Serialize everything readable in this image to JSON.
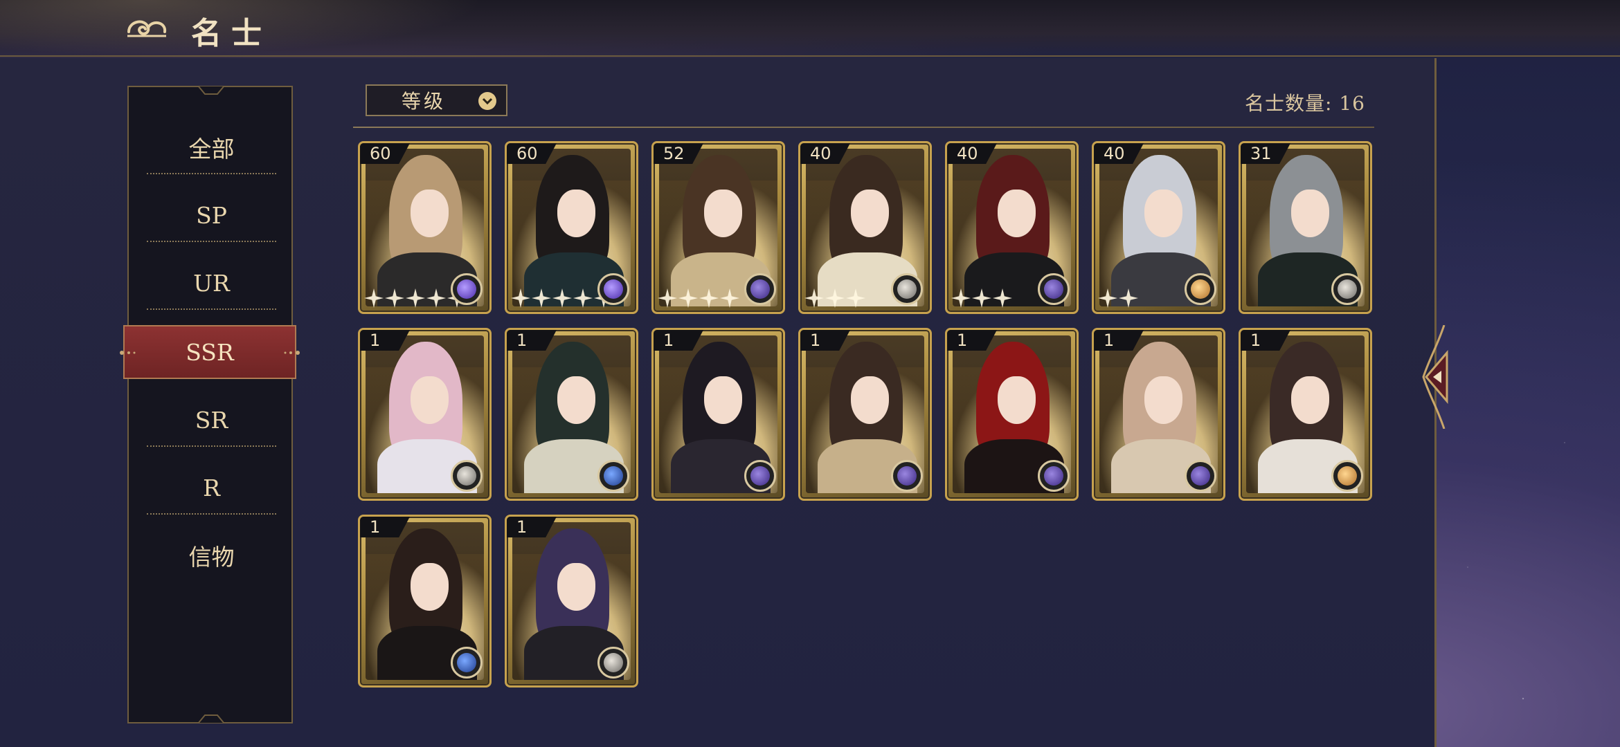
{
  "header": {
    "title": "名士"
  },
  "sidebar": {
    "tabs": [
      {
        "label": "全部"
      },
      {
        "label": "SP"
      },
      {
        "label": "UR"
      },
      {
        "label": "SSR"
      },
      {
        "label": "SR"
      },
      {
        "label": "R"
      },
      {
        "label": "信物"
      }
    ],
    "active_tab": "SSR"
  },
  "sort": {
    "label": "等级"
  },
  "count": {
    "label": "名士数量: 16"
  },
  "colors": {
    "accent_gold": "#c7a24e",
    "active_tab": "#8d3232",
    "panel": "#222340"
  },
  "cards": [
    {
      "level": "60",
      "stars": 5,
      "faction": "purple-orb",
      "hair": "#b89a74",
      "outfit": "#2b2a2a"
    },
    {
      "level": "60",
      "stars": 5,
      "faction": "purple-orb",
      "hair": "#1e1a1a",
      "outfit": "#1f2f33"
    },
    {
      "level": "52",
      "stars": 4,
      "faction": "purple",
      "hair": "#4a3424",
      "outfit": "#c9b48a"
    },
    {
      "level": "40",
      "stars": 3,
      "faction": "silver",
      "hair": "#3a2a20",
      "outfit": "#e6dcc4"
    },
    {
      "level": "40",
      "stars": 3,
      "faction": "purple",
      "hair": "#5a1a1a",
      "outfit": "#1a1a1c"
    },
    {
      "level": "40",
      "stars": 2,
      "faction": "gold",
      "hair": "#c9ccd4",
      "outfit": "#3a3a40"
    },
    {
      "level": "31",
      "stars": 0,
      "faction": "silver",
      "hair": "#8c9094",
      "outfit": "#1e2624"
    },
    {
      "level": "1",
      "stars": 0,
      "faction": "silver",
      "hair": "#e2b8c8",
      "outfit": "#e6e2ea"
    },
    {
      "level": "1",
      "stars": 0,
      "faction": "blue",
      "hair": "#24302c",
      "outfit": "#d6d2c0"
    },
    {
      "level": "1",
      "stars": 0,
      "faction": "purple",
      "hair": "#1e1a22",
      "outfit": "#2a2630"
    },
    {
      "level": "1",
      "stars": 0,
      "faction": "purple",
      "hair": "#3a2a22",
      "outfit": "#c6b08a"
    },
    {
      "level": "1",
      "stars": 0,
      "faction": "purple",
      "hair": "#8c1616",
      "outfit": "#1c1414"
    },
    {
      "level": "1",
      "stars": 0,
      "faction": "purple",
      "hair": "#c8a890",
      "outfit": "#d8c8b0"
    },
    {
      "level": "1",
      "stars": 0,
      "faction": "gold",
      "hair": "#3a2a26",
      "outfit": "#e6e0d8"
    },
    {
      "level": "1",
      "stars": 0,
      "faction": "blue",
      "hair": "#2a1e1a",
      "outfit": "#1a1616"
    },
    {
      "level": "1",
      "stars": 0,
      "faction": "silver",
      "hair": "#3a3058",
      "outfit": "#222026"
    }
  ]
}
